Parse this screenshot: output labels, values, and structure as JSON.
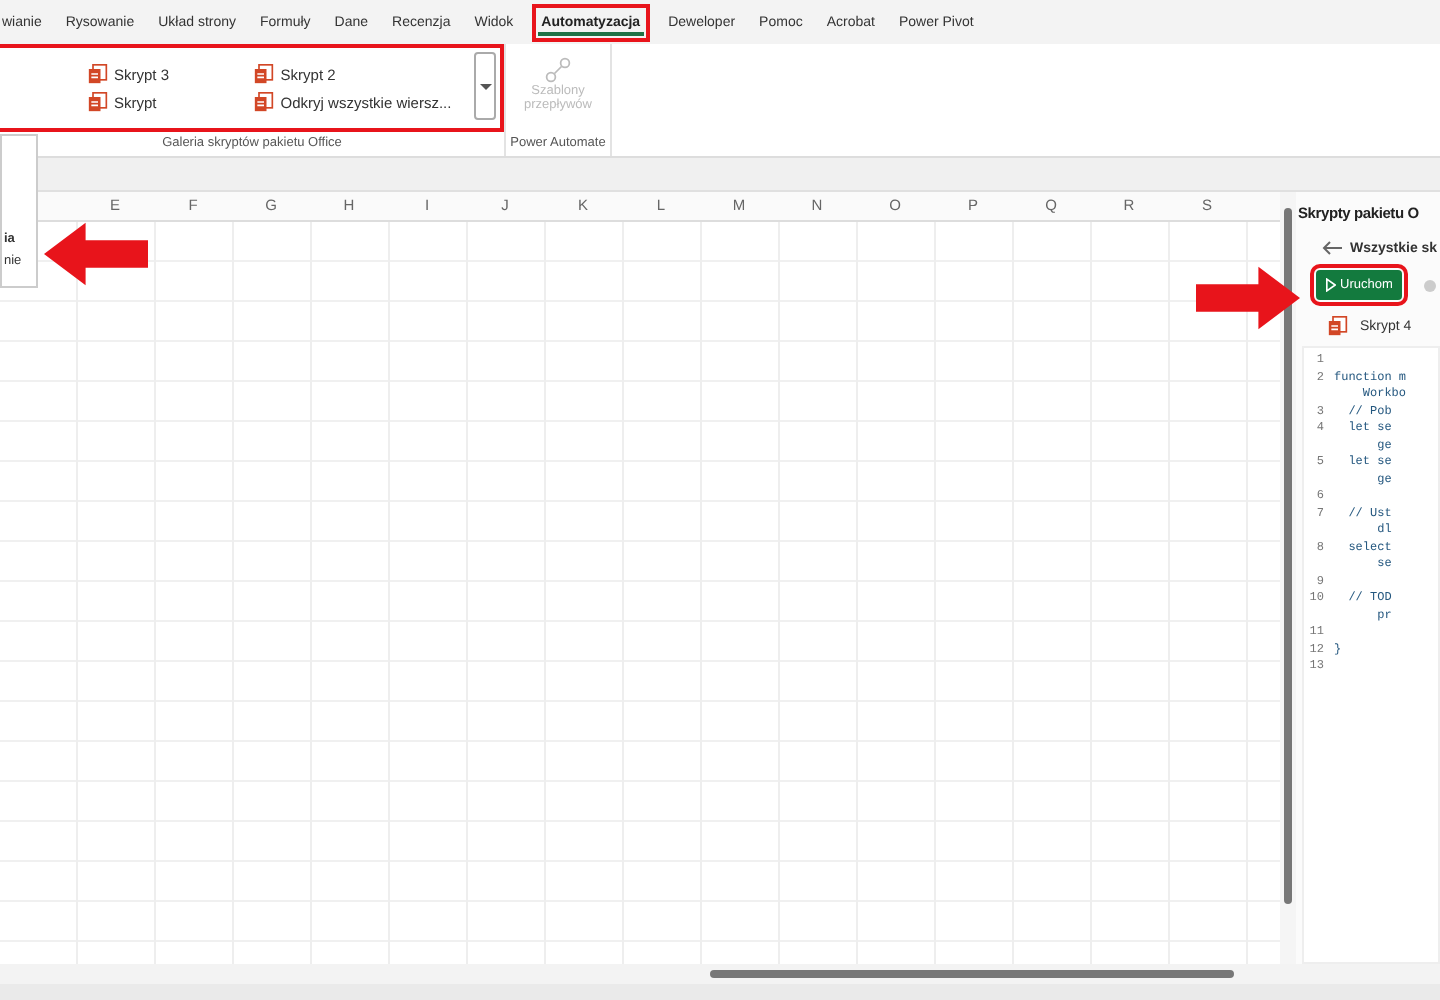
{
  "ribbon_tabs": [
    {
      "label": "wianie",
      "selected": false
    },
    {
      "label": "Rysowanie",
      "selected": false
    },
    {
      "label": "Układ strony",
      "selected": false
    },
    {
      "label": "Formuły",
      "selected": false
    },
    {
      "label": "Dane",
      "selected": false
    },
    {
      "label": "Recenzja",
      "selected": false
    },
    {
      "label": "Widok",
      "selected": false
    },
    {
      "label": "Automatyzacja",
      "selected": true
    },
    {
      "label": "Deweloper",
      "selected": false
    },
    {
      "label": "Pomoc",
      "selected": false
    },
    {
      "label": "Acrobat",
      "selected": false
    },
    {
      "label": "Power Pivot",
      "selected": false
    }
  ],
  "script_gallery": {
    "items": [
      {
        "label": "Skrypt 3"
      },
      {
        "label": "Skrypt"
      },
      {
        "label": "Skrypt 2"
      },
      {
        "label": "Odkryj wszystkie wiersz..."
      }
    ],
    "group_label": "Galeria skryptów pakietu Office"
  },
  "power_automate": {
    "button": {
      "label": "Szablony przepływów",
      "disabled": true
    },
    "group_label": "Power Automate"
  },
  "side_menu": {
    "items": [
      {
        "label": "ia",
        "bold": true
      },
      {
        "label": "nie",
        "bold": false
      }
    ]
  },
  "sheet": {
    "columns": [
      "",
      "E",
      "F",
      "G",
      "H",
      "I",
      "J",
      "K",
      "L",
      "M",
      "N",
      "O",
      "P",
      "Q",
      "R",
      "S"
    ]
  },
  "scripts_pane": {
    "title": "Skrypty pakietu O",
    "back_label": "Wszystkie sk",
    "run_button": "Uruchom",
    "script_name": "Skrypt 4",
    "code": [
      {
        "number": "1"
      },
      {
        "number": "2",
        "lines": [
          "function m",
          "    Workbo"
        ]
      },
      {
        "number": "3",
        "lines": [
          "  // Pob"
        ]
      },
      {
        "number": "4",
        "lines": [
          "  let se",
          "      ge"
        ]
      },
      {
        "number": "5",
        "lines": [
          "  let se",
          "      ge"
        ]
      },
      {
        "number": "6"
      },
      {
        "number": "7",
        "lines": [
          "  // Ust",
          "      dl"
        ]
      },
      {
        "number": "8",
        "lines": [
          "  select",
          "      se"
        ]
      },
      {
        "number": "9"
      },
      {
        "number": "10",
        "lines": [
          "  // TOD",
          "      pr"
        ]
      },
      {
        "number": "11"
      },
      {
        "number": "12",
        "lines": [
          "}"
        ]
      },
      {
        "number": "13"
      }
    ]
  }
}
